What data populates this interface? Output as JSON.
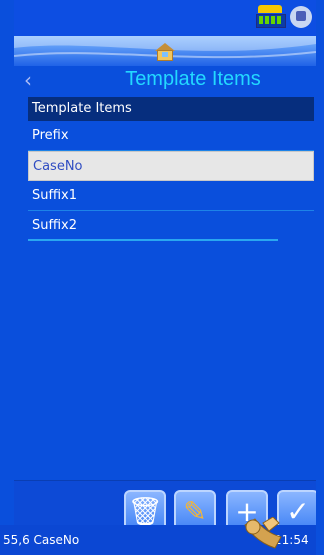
{
  "header": {
    "title": "Template Items",
    "back_icon": "chevron-left-icon",
    "home_icon": "home-icon",
    "status_icons": [
      "battery-icon",
      "settings-icon"
    ]
  },
  "list": {
    "header": "Template Items",
    "items": [
      {
        "label": "Prefix",
        "selected": false
      },
      {
        "label": "CaseNo",
        "selected": true
      },
      {
        "label": "Suffix1",
        "selected": false
      },
      {
        "label": "Suffix2",
        "selected": false
      }
    ]
  },
  "toolbar": {
    "buttons": [
      {
        "name": "delete",
        "icon": "trash-icon"
      },
      {
        "name": "edit",
        "icon": "edit-icon"
      },
      {
        "name": "add",
        "icon": "plus-icon"
      },
      {
        "name": "confirm",
        "icon": "check-icon"
      }
    ]
  },
  "footer": {
    "left": "55,6 CaseNo",
    "right": "21:54"
  },
  "colors": {
    "background": "#0a4fdc",
    "title": "#23d8ff",
    "header_bg": "#062e7e",
    "selected_bg": "#e7e7e7",
    "selected_text": "#2f4cc2"
  }
}
